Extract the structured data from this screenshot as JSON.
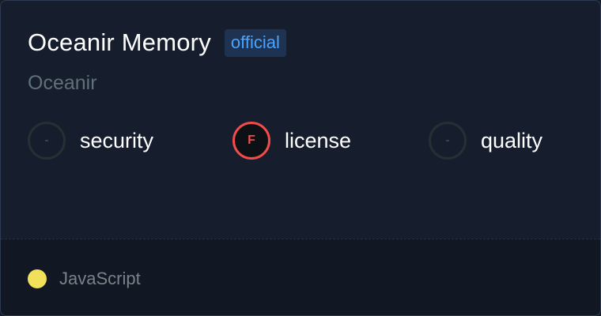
{
  "card": {
    "title": "Oceanir Memory",
    "badge": "official",
    "owner": "Oceanir"
  },
  "scores": [
    {
      "name": "security",
      "grade": "-",
      "status": "none",
      "color": "#262f34"
    },
    {
      "name": "license",
      "grade": "F",
      "status": "fail",
      "color": "#f14b4b"
    },
    {
      "name": "quality",
      "grade": "-",
      "status": "none",
      "color": "#262f34"
    }
  ],
  "footer": {
    "language": "JavaScript",
    "language_color": "#f1e05a"
  }
}
